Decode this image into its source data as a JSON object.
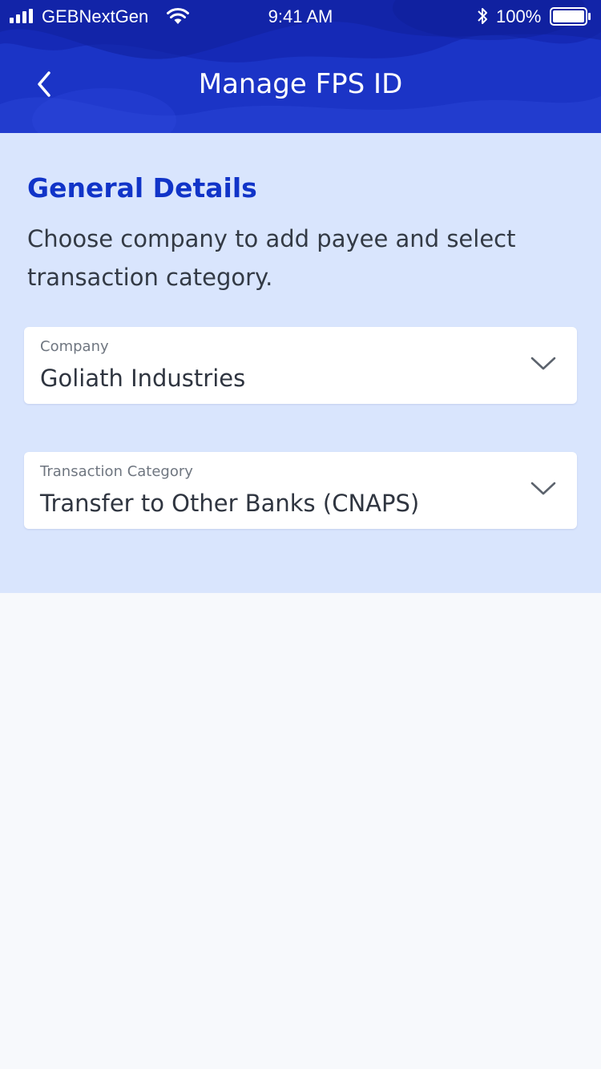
{
  "status_bar": {
    "carrier": "GEBNextGen",
    "time": "9:41 AM",
    "battery": "100%",
    "icons": [
      "signal-icon",
      "wifi-icon",
      "bluetooth-icon",
      "battery-icon"
    ]
  },
  "header": {
    "title": "Manage FPS ID",
    "back_icon": "chevron-left-icon"
  },
  "details": {
    "title": "General Details",
    "description": "Choose company to add payee and select transaction category.",
    "fields": [
      {
        "label": "Company",
        "value": "Goliath Industries",
        "icon": "chevron-down-icon"
      },
      {
        "label": "Transaction Category",
        "value": "Transfer to Other Banks (CNAPS)",
        "icon": "chevron-down-icon"
      }
    ]
  },
  "colors": {
    "header_bg": "#1b34c6",
    "section_bg": "#d9e5fd",
    "accent": "#1134c8",
    "page_bg": "#f7f9fc"
  }
}
